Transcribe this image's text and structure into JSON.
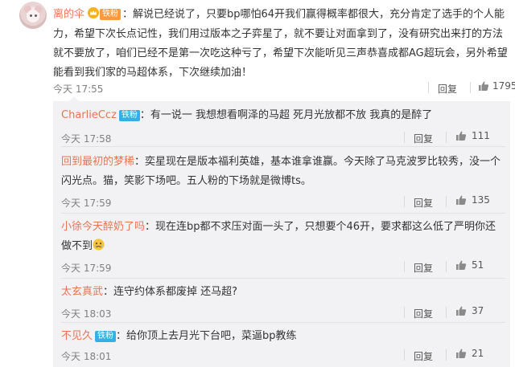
{
  "main_comment": {
    "username": "离的伞",
    "fan_badge": "铁粉",
    "text": "：解说已经说了，只要bp哪怕64开我们赢得概率都很大，充分肯定了选手的个人能力，希望下次长点记性，我们用过版本之子弈星了，就不要让对面拿到了，没有研究出来打的方法就不要放了，咱们已经不是第一次吃这种亏了，希望下次能听见三声恭喜成都AG超玩会，另外希望能看到我们家的马超体系，下次继续加油！",
    "time": "今天 17:55",
    "reply_label": "回复",
    "likes": "1795",
    "icons": {
      "crown": "crown-icon",
      "like": "thumbs-up-icon",
      "avatar": "avatar-image"
    },
    "colors": {
      "username": "#eb7350",
      "fan_badge": "#ff9a3c"
    }
  },
  "replies": [
    {
      "username": "CharlieCcz",
      "badge": "铁粉",
      "text": "：有一说一 我想想看啊泽的马超 死月光放都不放 我真的是醉了",
      "time": "今天 17:58",
      "reply_label": "回复",
      "likes": "111"
    },
    {
      "username": "回到最初的梦稀",
      "badge": "",
      "text": "：奕星现在是版本福利英雄，基本谁拿谁赢。今天除了马克波罗比较秀，没一个闪光点。猫，笑影下场吧。五人粉的下场就是微博ts。",
      "time": "今天 17:59",
      "reply_label": "回复",
      "likes": "135"
    },
    {
      "username": "小徐今天醉奶了吗",
      "badge": "",
      "text": "：现在连bp都不求压对面一头了，只想要个46开，要求都这么低了严明你还做不到",
      "emoji": "crying-emoji",
      "time": "今天 17:59",
      "reply_label": "回复",
      "likes": "51"
    },
    {
      "username": "太玄真武",
      "badge": "",
      "text": "：连守约体系都废掉 还马超?",
      "time": "今天 18:03",
      "reply_label": "回复",
      "likes": "37"
    },
    {
      "username": "不见久",
      "badge": "铁粉",
      "text": "：给你顶上去月光下台吧，菜逼bp教练",
      "time": "今天 18:01",
      "reply_label": "回复",
      "likes": "21"
    }
  ],
  "colors": {
    "link": "#eb7350",
    "iron_badge": "#33b0e6",
    "reply_bg": "#f2f2f5"
  }
}
